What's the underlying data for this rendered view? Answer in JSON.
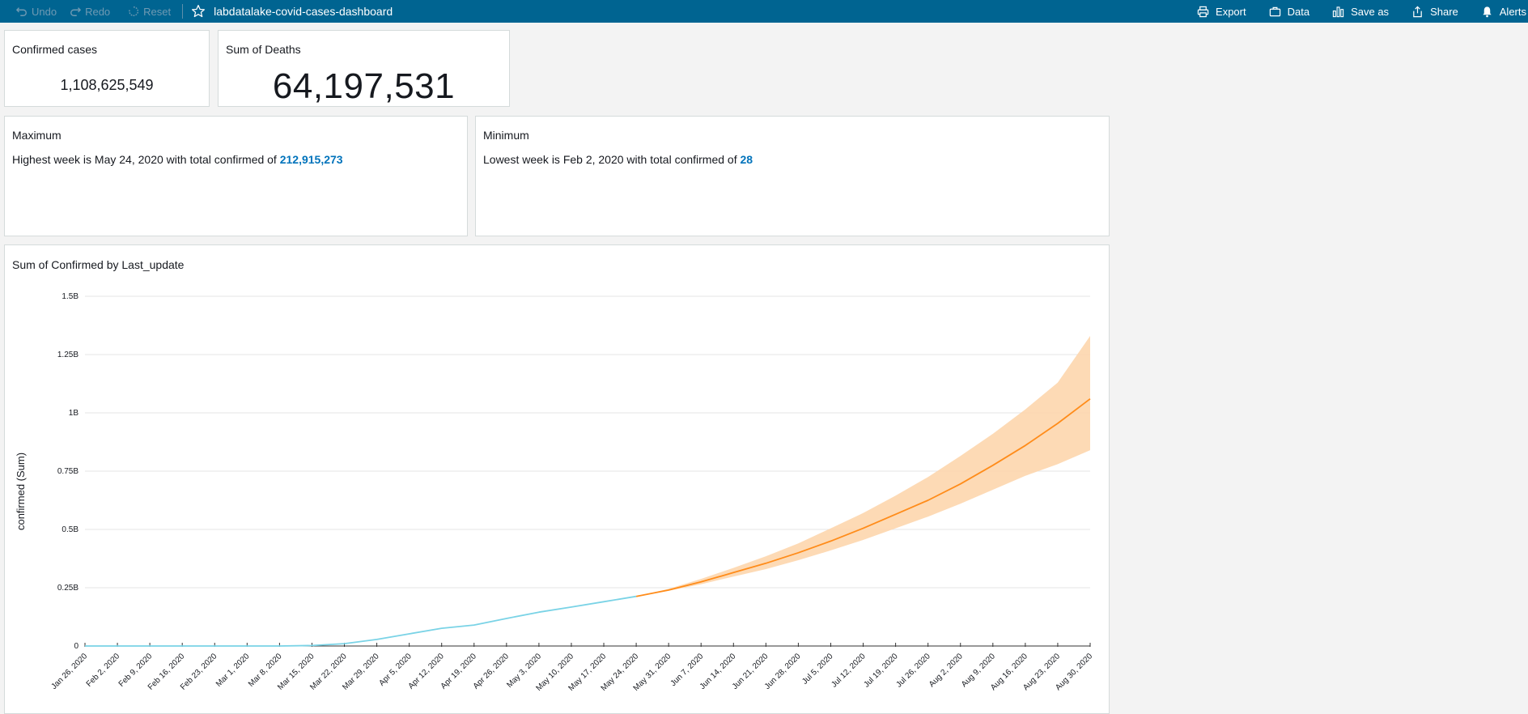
{
  "topbar": {
    "undo": "Undo",
    "redo": "Redo",
    "reset": "Reset",
    "title": "labdatalake-covid-cases-dashboard",
    "export": "Export",
    "data": "Data",
    "save_as": "Save as",
    "share": "Share",
    "alerts": "Alerts"
  },
  "kpi_confirmed": {
    "title": "Confirmed cases",
    "value": "1,108,625,549"
  },
  "kpi_deaths": {
    "title": "Sum of Deaths",
    "value": "64,197,531"
  },
  "insight_max": {
    "title": "Maximum",
    "prefix": "Highest week is May 24, 2020 with total confirmed of ",
    "value": "212,915,273"
  },
  "insight_min": {
    "title": "Minimum",
    "prefix": "Lowest week is Feb 2, 2020 with total confirmed of ",
    "value": "28"
  },
  "chart_title": "Sum of Confirmed by Last_update",
  "colors": {
    "actual": "#7ad3e6",
    "forecast": "#ff8c1a",
    "band": "#fdd3a8",
    "highlight": "#0073bb",
    "topbar": "#006491"
  },
  "chart_data": {
    "type": "line",
    "title": "Sum of Confirmed by Last_update",
    "ylabel": "confirmed (Sum)",
    "xlabel": "",
    "ylim": [
      0,
      1500000000
    ],
    "yticks": [
      0,
      250000000,
      500000000,
      750000000,
      1000000000,
      1250000000,
      1500000000
    ],
    "ytick_labels": [
      "0",
      "0.25B",
      "0.5B",
      "0.75B",
      "1B",
      "1.25B",
      "1.5B"
    ],
    "x": [
      "Jan 26, 2020",
      "Feb 2, 2020",
      "Feb 9, 2020",
      "Feb 16, 2020",
      "Feb 23, 2020",
      "Mar 1, 2020",
      "Mar 8, 2020",
      "Mar 15, 2020",
      "Mar 22, 2020",
      "Mar 29, 2020",
      "Apr 5, 2020",
      "Apr 12, 2020",
      "Apr 19, 2020",
      "Apr 26, 2020",
      "May 3, 2020",
      "May 10, 2020",
      "May 17, 2020",
      "May 24, 2020",
      "May 31, 2020",
      "Jun 7, 2020",
      "Jun 14, 2020",
      "Jun 21, 2020",
      "Jun 28, 2020",
      "Jul 5, 2020",
      "Jul 12, 2020",
      "Jul 19, 2020",
      "Jul 26, 2020",
      "Aug 2, 2020",
      "Aug 9, 2020",
      "Aug 16, 2020",
      "Aug 23, 2020",
      "Aug 30, 2020"
    ],
    "grid": true,
    "series": [
      {
        "values": [
          0,
          0,
          0,
          0,
          0,
          0,
          0,
          2000000,
          10000000,
          28000000,
          52000000,
          76000000,
          90000000,
          118000000,
          145000000,
          167000000,
          190000000,
          212915273,
          null,
          null,
          null,
          null,
          null,
          null,
          null,
          null,
          null,
          null,
          null,
          null,
          null,
          null
        ]
      },
      {
        "values": [
          null,
          null,
          null,
          null,
          null,
          null,
          null,
          null,
          null,
          null,
          null,
          null,
          null,
          null,
          null,
          null,
          null,
          212915273,
          240000000,
          275000000,
          315000000,
          355000000,
          400000000,
          450000000,
          505000000,
          565000000,
          625000000,
          695000000,
          775000000,
          860000000,
          955000000,
          1060000000
        ]
      }
    ],
    "band": {
      "upper": [
        212915273,
        245000000,
        288000000,
        335000000,
        385000000,
        440000000,
        505000000,
        570000000,
        645000000,
        725000000,
        815000000,
        910000000,
        1015000000,
        1130000000,
        1330000000
      ],
      "lower": [
        212915273,
        237000000,
        265000000,
        298000000,
        330000000,
        368000000,
        410000000,
        455000000,
        505000000,
        555000000,
        610000000,
        670000000,
        730000000,
        780000000,
        840000000
      ]
    }
  }
}
